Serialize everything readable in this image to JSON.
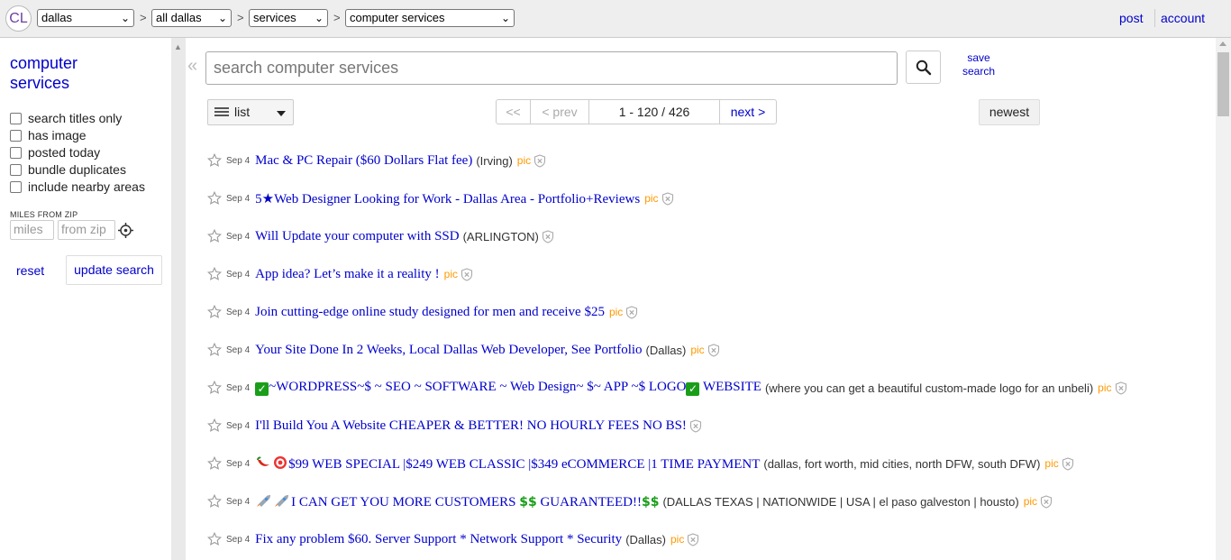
{
  "header": {
    "logo": "CL",
    "crumbs": [
      {
        "value": "dallas"
      },
      {
        "value": "all dallas"
      },
      {
        "value": "services"
      },
      {
        "value": "computer services"
      }
    ],
    "separator": ">",
    "post": "post",
    "account": "account"
  },
  "sidebar": {
    "category_line1": "computer",
    "category_line2": "services",
    "options": [
      "search titles only",
      "has image",
      "posted today",
      "bundle duplicates",
      "include nearby areas"
    ],
    "miles_from_zip_label": "MILES FROM ZIP",
    "miles_placeholder": "miles",
    "zip_placeholder": "from zip",
    "reset": "reset",
    "update": "update search"
  },
  "search": {
    "placeholder": "search computer services",
    "save_line1": "save",
    "save_line2": "search",
    "collapse_glyph": "«"
  },
  "controls": {
    "view": "list",
    "first": "<<",
    "prev": "< prev",
    "range": "1 - 120 / 426",
    "next": "next >",
    "sort": "newest"
  },
  "listings": [
    {
      "date": "Sep 4",
      "title": "Mac & PC Repair ($60 Dollars Flat fee)",
      "loc": "(Irving)",
      "pic": "pic"
    },
    {
      "date": "Sep 4",
      "title": "5★Web Designer Looking for Work - Dallas Area - Portfolio+Reviews",
      "loc": "",
      "pic": "pic"
    },
    {
      "date": "Sep 4",
      "title": "Will Update your computer with SSD",
      "loc": "(ARLINGTON)",
      "pic": ""
    },
    {
      "date": "Sep 4",
      "title": "App idea? Let’s make it a reality !",
      "loc": "",
      "pic": "pic"
    },
    {
      "date": "Sep 4",
      "title": "Join cutting-edge online study designed for men and receive $25",
      "loc": "",
      "pic": "pic"
    },
    {
      "date": "Sep 4",
      "title": "Your Site Done In 2 Weeks, Local Dallas Web Developer, See Portfolio",
      "loc": "(Dallas)",
      "pic": "pic"
    },
    {
      "date": "Sep 4",
      "title_a": "~WORDPRESS~$ ~ SEO ~ SOFTWARE ~ Web Design~ $~ APP ~$ LOGO",
      "title_b": " WEBSITE",
      "check": "✓",
      "loc": "(where you can get a beautiful custom-made logo for an unbeli)",
      "pic": "pic"
    },
    {
      "date": "Sep 4",
      "title": "I'll Build You A Website CHEAPER & BETTER! NO HOURLY FEES NO BS!",
      "loc": "",
      "pic": ""
    },
    {
      "date": "Sep 4",
      "title": "$99 WEB SPECIAL |$249 WEB CLASSIC |$349 eCOMMERCE |1 TIME PAYMENT",
      "loc": "(dallas, fort worth, mid cities, north DFW, south DFW)",
      "pic": "pic"
    },
    {
      "date": "Sep 4",
      "title_a": "I CAN GET YOU MORE CUSTOMERS ",
      "title_b": " GUARANTEED!!",
      "dollars": "$$",
      "loc": "(DALLAS TEXAS | NATIONWIDE | USA | el paso galveston | housto)",
      "pic": "pic"
    },
    {
      "date": "Sep 4",
      "title": "Fix any problem $60. Server Support * Network Support * Security",
      "loc": "(Dallas)",
      "pic": "pic"
    }
  ],
  "colors": {
    "link": "#0000cc",
    "pic": "#ff9900",
    "topbar": "#eeeeee",
    "emoji_green": "#1a9e1a"
  },
  "icons": [
    "star-icon",
    "hide-icon",
    "search-icon",
    "locate-icon",
    "list-view-icon",
    "chevron-down-icon"
  ]
}
